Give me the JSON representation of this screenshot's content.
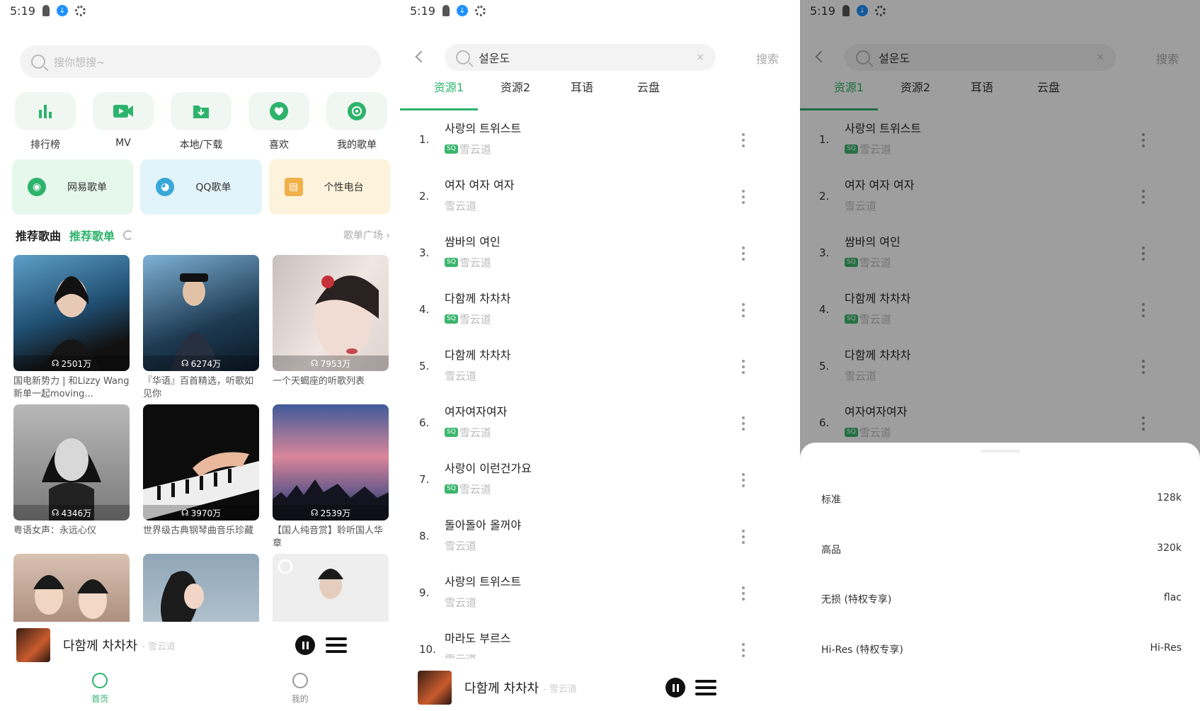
{
  "status": {
    "time": "5:19",
    "dl_icon": "download-badge-icon"
  },
  "home": {
    "search_placeholder": "搜你想搜~",
    "quick": [
      {
        "label": "排行榜",
        "icon": "ranking-bars-icon"
      },
      {
        "label": "MV",
        "icon": "video-icon"
      },
      {
        "label": "本地/下载",
        "icon": "folder-download-icon"
      },
      {
        "label": "喜欢",
        "icon": "heart-icon"
      },
      {
        "label": "我的歌单",
        "icon": "disc-icon"
      }
    ],
    "cards": [
      {
        "label": "网易歌单",
        "bg": "#e6f7ec",
        "icon_color": "#2db36b"
      },
      {
        "label": "QQ歌单",
        "bg": "#e3f3fa",
        "icon_color": "#38a8d8"
      },
      {
        "label": "个性电台",
        "bg": "#fdf3dc",
        "icon_color": "#f0b04a"
      }
    ],
    "rec_songs": "推荐歌曲",
    "rec_playlists": "推荐歌单",
    "square": "歌单广场 ›",
    "playlists": [
      {
        "plays": "2501万",
        "title": "国电新势力 | 和Lizzy Wang新单一起moving..."
      },
      {
        "plays": "6274万",
        "title": "『华语』百首精选，听歌如见你"
      },
      {
        "plays": "7953万",
        "title": "一个天蝎座的听歌列表"
      },
      {
        "plays": "4346万",
        "title": "粤语女声：永远心仪"
      },
      {
        "plays": "3970万",
        "title": "世界级古典钢琴曲音乐珍藏"
      },
      {
        "plays": "2539万",
        "title": "【国人纯音赏】聆听国人华章"
      },
      {
        "plays": "",
        "title": ""
      },
      {
        "plays": "",
        "title": ""
      },
      {
        "plays": "",
        "title": ""
      }
    ],
    "nav": [
      {
        "label": "首页",
        "color": "#2db36b"
      },
      {
        "label": "我的",
        "color": "#888"
      }
    ]
  },
  "player": {
    "title": "다함께 차차차",
    "artist": "- 雪云道"
  },
  "search": {
    "query": "설운도",
    "clear": "×",
    "button": "搜索",
    "tabs": [
      "资源1",
      "资源2",
      "耳语",
      "云盘"
    ],
    "songs": [
      {
        "num": "1.",
        "title": "사랑의 트위스트",
        "artist": "雪云道",
        "sq": "SQ"
      },
      {
        "num": "2.",
        "title": "여자 여자 여자",
        "artist": "雪云道",
        "sq": ""
      },
      {
        "num": "3.",
        "title": "쌈바의 여인",
        "artist": "雪云道",
        "sq": "SQ"
      },
      {
        "num": "4.",
        "title": "다함께 차차차",
        "artist": "雪云道",
        "sq": "SQ"
      },
      {
        "num": "5.",
        "title": "다함께 차차차",
        "artist": "雪云道",
        "sq": ""
      },
      {
        "num": "6.",
        "title": "여자여자여자",
        "artist": "雪云道",
        "sq": "SQ"
      },
      {
        "num": "7.",
        "title": "사랑이 이런건가요",
        "artist": "雪云道",
        "sq": "SQ"
      },
      {
        "num": "8.",
        "title": "돌아돌아 올꺼야",
        "artist": "雪云道",
        "sq": ""
      },
      {
        "num": "9.",
        "title": "사랑의 트위스트",
        "artist": "雪云道",
        "sq": ""
      },
      {
        "num": "10.",
        "title": "마라도 부르스",
        "artist": "雪云道",
        "sq": ""
      }
    ]
  },
  "quality": [
    {
      "label": "标准",
      "value": "128k"
    },
    {
      "label": "高品",
      "value": "320k"
    },
    {
      "label": "无损 (特权专享)",
      "value": "flac"
    },
    {
      "label": "Hi-Res (特权专享)",
      "value": "Hi-Res"
    }
  ]
}
